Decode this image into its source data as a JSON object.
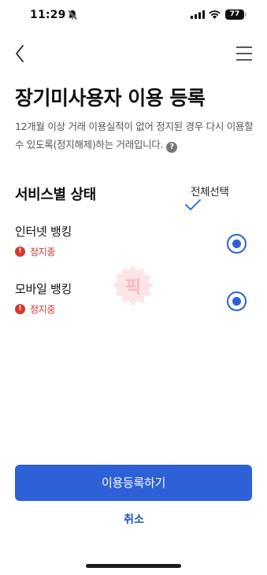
{
  "status_bar": {
    "time": "11:29",
    "battery": "77"
  },
  "header": {
    "title": "장기미사용자 이용 등록"
  },
  "description": "12개월 이상 거래 이용실적이 없어 정지된 경우 다시 이용할 수 있도록(정지해제)하는 거래입니다.",
  "help_glyph": "?",
  "services_section": {
    "title": "서비스별 상태",
    "select_all_label": "전체선택",
    "items": [
      {
        "name": "인터넷 뱅킹",
        "status": "정지중",
        "selected": true
      },
      {
        "name": "모바일 뱅킹",
        "status": "정지중",
        "selected": true
      }
    ]
  },
  "alert_glyph": "!",
  "watermark_text": "픽",
  "actions": {
    "primary_label": "이용등록하기",
    "cancel_label": "취소"
  },
  "colors": {
    "primary": "#2e60d8",
    "alert": "#d9352b",
    "cancel_text": "#2450b8"
  }
}
